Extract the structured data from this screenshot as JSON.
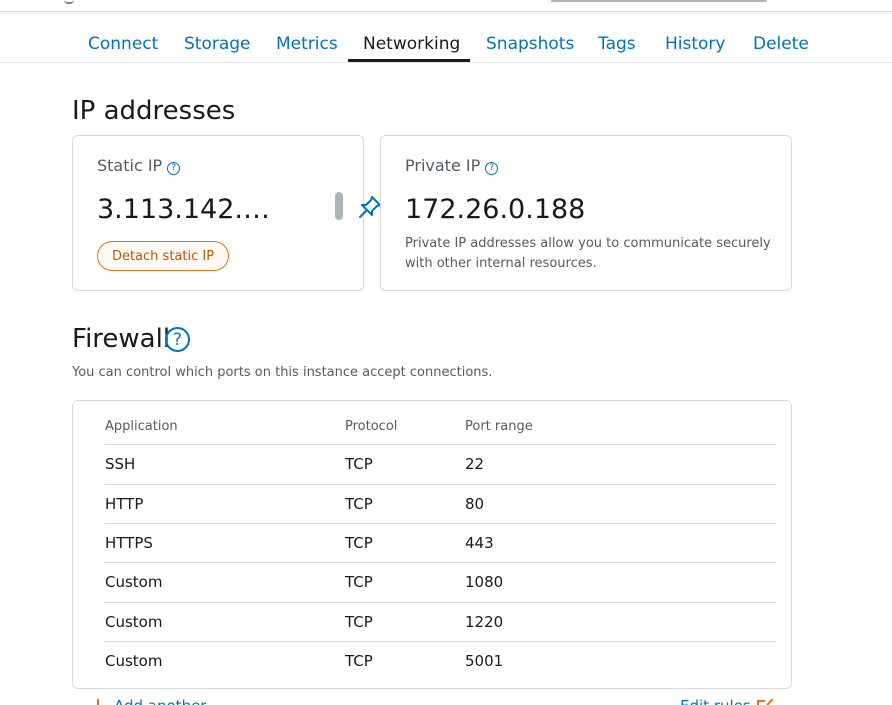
{
  "tabs": [
    {
      "label": "Connect"
    },
    {
      "label": "Storage"
    },
    {
      "label": "Metrics"
    },
    {
      "label": "Networking",
      "active": true
    },
    {
      "label": "Snapshots"
    },
    {
      "label": "Tags"
    },
    {
      "label": "History"
    },
    {
      "label": "Delete"
    }
  ],
  "ip_section": {
    "title": "IP addresses",
    "static": {
      "label": "Static IP",
      "help": "?",
      "value": "3.113.142.…",
      "button": "Detach static IP",
      "pin_icon": "pin-icon"
    },
    "private": {
      "label": "Private IP",
      "help": "?",
      "value": "172.26.0.188",
      "description": "Private IP addresses allow you to communicate securely with other internal resources."
    }
  },
  "firewall": {
    "title": "Firewall",
    "help": "?",
    "description": "You can control which ports on this instance accept connections.",
    "columns": [
      "Application",
      "Protocol",
      "Port range"
    ],
    "rows": [
      {
        "app": "SSH",
        "protocol": "TCP",
        "port": "22"
      },
      {
        "app": "HTTP",
        "protocol": "TCP",
        "port": "80"
      },
      {
        "app": "HTTPS",
        "protocol": "TCP",
        "port": "443"
      },
      {
        "app": "Custom",
        "protocol": "TCP",
        "port": "1080"
      },
      {
        "app": "Custom",
        "protocol": "TCP",
        "port": "1220"
      },
      {
        "app": "Custom",
        "protocol": "TCP",
        "port": "5001"
      }
    ],
    "add_link": "Add another",
    "edit_link": "Edit rules"
  },
  "colors": {
    "link": "#0073bb",
    "accent": "#ec7211",
    "text": "#16191f",
    "muted": "#545b64",
    "border": "#d5dbdb"
  }
}
